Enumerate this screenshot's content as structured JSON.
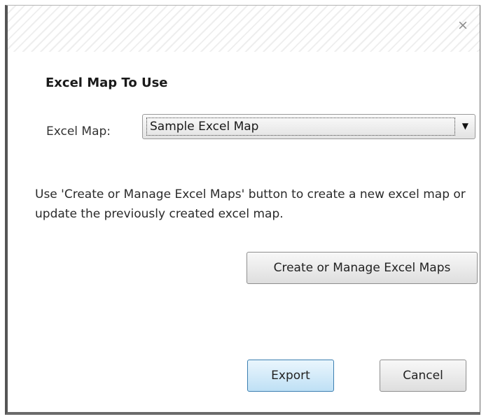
{
  "dialog": {
    "close_glyph": "×",
    "section_title": "Excel Map To Use",
    "excel_map": {
      "label": "Excel Map:",
      "selected_value": "Sample Excel Map"
    },
    "help_text": "Use 'Create or Manage Excel Maps' button to create a new excel map or update the previously created excel map.",
    "buttons": {
      "manage": "Create or Manage Excel Maps",
      "export": "Export",
      "cancel": "Cancel"
    }
  }
}
